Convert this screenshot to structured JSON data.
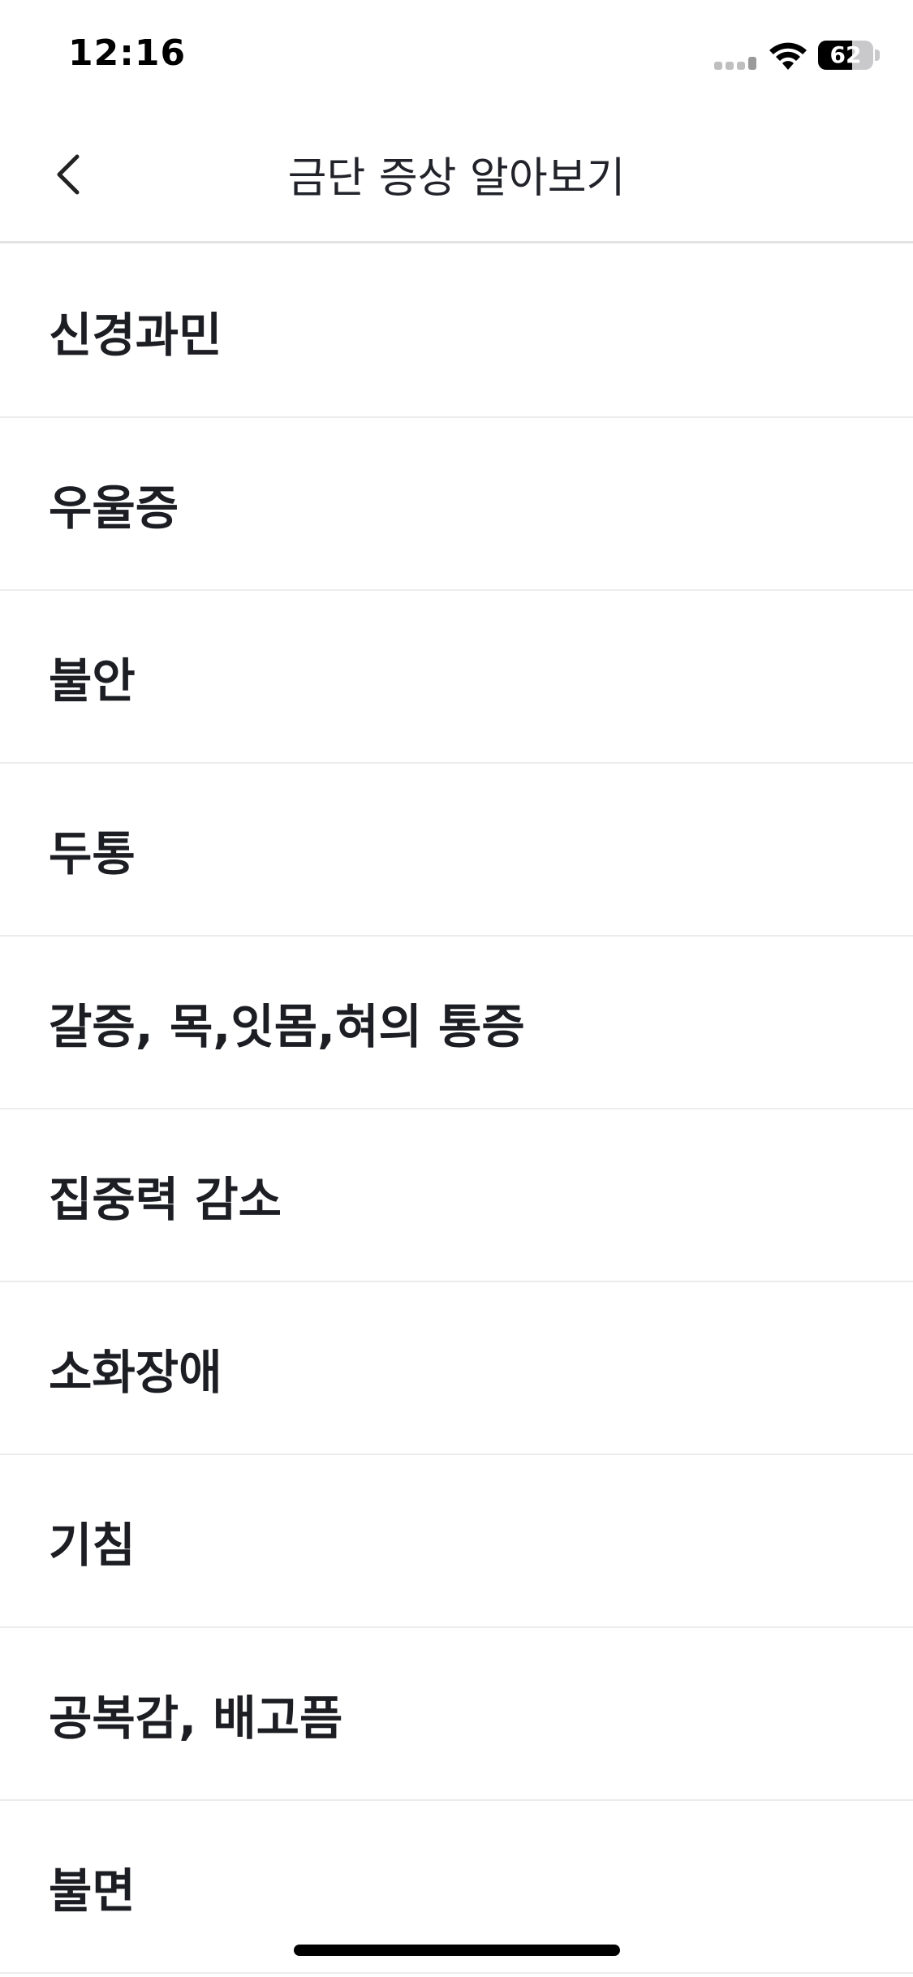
{
  "status_bar": {
    "time": "12:16",
    "battery_level": "62",
    "battery_fraction": 0.62,
    "signal_icon": "cellular-signal-icon",
    "wifi_icon": "wifi-icon",
    "battery_icon": "battery-icon"
  },
  "header": {
    "title": "금단 증상 알아보기",
    "back_icon": "chevron-left-icon"
  },
  "symptoms": [
    {
      "label": "신경과민"
    },
    {
      "label": "우울증"
    },
    {
      "label": "불안"
    },
    {
      "label": "두통"
    },
    {
      "label": "갈증, 목,잇몸,혀의 통증"
    },
    {
      "label": "집중력 감소"
    },
    {
      "label": "소화장애"
    },
    {
      "label": "기침"
    },
    {
      "label": "공복감, 배고픔"
    },
    {
      "label": "불면"
    }
  ],
  "colors": {
    "text": "#1d1e24",
    "divider": "#ececef",
    "background": "#ffffff"
  }
}
